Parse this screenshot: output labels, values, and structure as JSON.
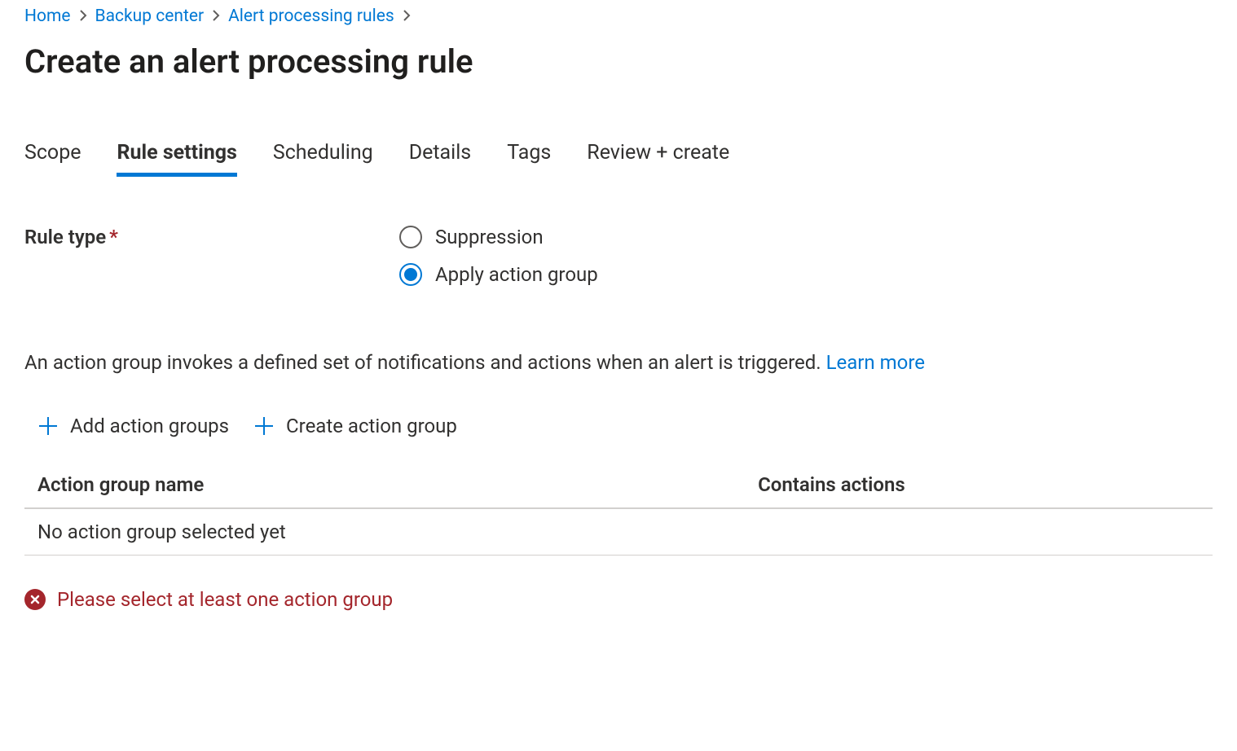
{
  "breadcrumb": {
    "items": [
      {
        "label": "Home"
      },
      {
        "label": "Backup center"
      },
      {
        "label": "Alert processing rules"
      }
    ]
  },
  "page": {
    "title": "Create an alert processing rule"
  },
  "tabs": [
    {
      "label": "Scope",
      "active": false
    },
    {
      "label": "Rule settings",
      "active": true
    },
    {
      "label": "Scheduling",
      "active": false
    },
    {
      "label": "Details",
      "active": false
    },
    {
      "label": "Tags",
      "active": false
    },
    {
      "label": "Review + create",
      "active": false
    }
  ],
  "form": {
    "rule_type_label": "Rule type",
    "rule_type_options": [
      {
        "label": "Suppression",
        "selected": false
      },
      {
        "label": "Apply action group",
        "selected": true
      }
    ]
  },
  "description": {
    "text": "An action group invokes a defined set of notifications and actions when an alert is triggered. ",
    "link": "Learn more"
  },
  "actions": {
    "add_label": "Add action groups",
    "create_label": "Create action group"
  },
  "table": {
    "columns": {
      "name": "Action group name",
      "contains": "Contains actions"
    },
    "empty_row": "No action group selected yet"
  },
  "error": {
    "message": "Please select at least one action group"
  },
  "colors": {
    "link": "#0078d4",
    "error": "#a4262c"
  }
}
